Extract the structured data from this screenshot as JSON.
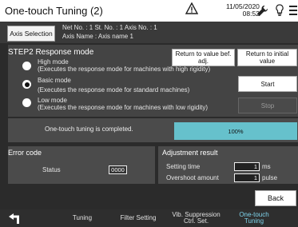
{
  "header": {
    "title": "One-touch Tuning (2)",
    "date": "11/05/2020",
    "time": "08:52"
  },
  "axis": {
    "button_label": "Axis Selection",
    "net_no": "Net No. :   1    St. No. :   1    Axis No. :  1",
    "axis_name": "Axis Name : Axis name 1"
  },
  "step2": {
    "title": "STEP2 Response mode",
    "modes": [
      {
        "name": "High mode",
        "desc": "(Executes the response mode for machines with high rigidity)",
        "selected": false
      },
      {
        "name": "Basic mode",
        "desc": "(Executes the response mode for standard machines)",
        "selected": true
      },
      {
        "name": "Low mode",
        "desc": "(Executes the response mode for machines with low rigidity)",
        "selected": false
      }
    ],
    "return_before_adj": "Return to value bef. adj.",
    "return_initial": "Return to initial value",
    "start_label": "Start",
    "stop_label": "Stop"
  },
  "progress": {
    "message": "One-touch tuning is completed.",
    "percent_text": "100%",
    "fraction": 1.0
  },
  "error": {
    "title": "Error code",
    "status_label": "Status",
    "status_value": "0000"
  },
  "adjustment": {
    "title": "Adjustment result",
    "rows": [
      {
        "label": "Setting time",
        "value": "1",
        "unit": "ms"
      },
      {
        "label": "Overshoot amount",
        "value": "1",
        "unit": "pulse"
      }
    ]
  },
  "back_label": "Back",
  "tabs": [
    {
      "label": "Tuning",
      "active": false
    },
    {
      "label": "Filter Setting",
      "active": false
    },
    {
      "label": "Vib. Suppression\nCtrl. Set.",
      "active": false
    },
    {
      "label": "One-touch\nTuning",
      "active": true
    }
  ],
  "colors": {
    "accent_progress": "#66c1cc",
    "active_tab": "#7fd4ec"
  }
}
